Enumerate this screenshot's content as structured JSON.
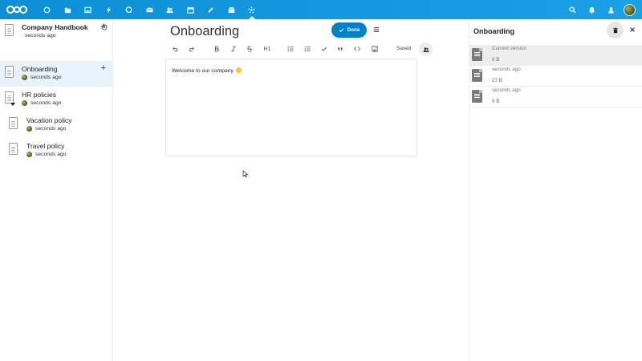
{
  "topbar": {
    "apps": [
      {
        "icon": "dashboard-icon"
      },
      {
        "icon": "files-icon"
      },
      {
        "icon": "photos-icon"
      },
      {
        "icon": "activity-icon"
      },
      {
        "icon": "talk-icon"
      },
      {
        "icon": "mail-icon"
      },
      {
        "icon": "contacts-icon"
      },
      {
        "icon": "calendar-icon"
      },
      {
        "icon": "notes-icon"
      },
      {
        "icon": "deck-icon"
      },
      {
        "icon": "collectives-icon",
        "active": true
      }
    ],
    "right": [
      "search-icon",
      "notifications-icon",
      "contacts-menu-icon",
      "user-avatar"
    ],
    "colors": {
      "bar": "#1aa0e4",
      "primary": "#0082c9"
    }
  },
  "sidebar": {
    "pages": [
      {
        "title": "Company Handbook",
        "meta": "seconds ago",
        "bold": true,
        "add": "+"
      },
      {
        "title": "Onboarding",
        "meta": "seconds ago",
        "active": true,
        "add": "+"
      },
      {
        "title": "HR policies",
        "meta": "seconds ago",
        "expanded": true
      },
      {
        "title": "Vacation policy",
        "meta": "seconds ago"
      },
      {
        "title": "Travel policy",
        "meta": "seconds ago"
      }
    ]
  },
  "editor": {
    "title": "Onboarding",
    "done_label": "Done",
    "saved_label": "Saved",
    "toolbar": {
      "heading_label": "H1"
    },
    "content": "Welcome to our company"
  },
  "versions": {
    "title": "Onboarding",
    "items": [
      {
        "label": "Current version",
        "size": "0 B",
        "current": true
      },
      {
        "label": "seconds ago",
        "size": "27 B"
      },
      {
        "label": "seconds ago",
        "size": "9 B"
      }
    ]
  }
}
